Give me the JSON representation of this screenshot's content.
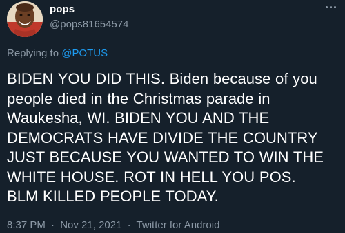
{
  "tweet": {
    "author": {
      "display_name": "pops",
      "handle": "@pops81654574",
      "avatar_icon": "user-avatar"
    },
    "more_icon": "more-horizontal-icon",
    "reply": {
      "prefix": "Replying to",
      "mention": "@POTUS"
    },
    "text_lines": [
      "BIDEN YOU DID THIS. Biden because of you",
      "people died in the Christmas parade in",
      "Waukesha, WI. BIDEN YOU AND THE",
      "DEMOCRATS HAVE DIVIDE THE COUNTRY",
      "JUST BECAUSE YOU WANTED TO WIN THE",
      "WHITE HOUSE. ROT IN HELL YOU POS.",
      "BLM KILLED PEOPLE TODAY."
    ],
    "meta": {
      "time": "8:37 PM",
      "date": "Nov 21, 2021",
      "separator": "·",
      "source": "Twitter for Android"
    }
  },
  "colors": {
    "background": "#15202b",
    "primary_text": "#ffffff",
    "secondary_text": "#8b98a5",
    "link": "#1d9bf0"
  }
}
